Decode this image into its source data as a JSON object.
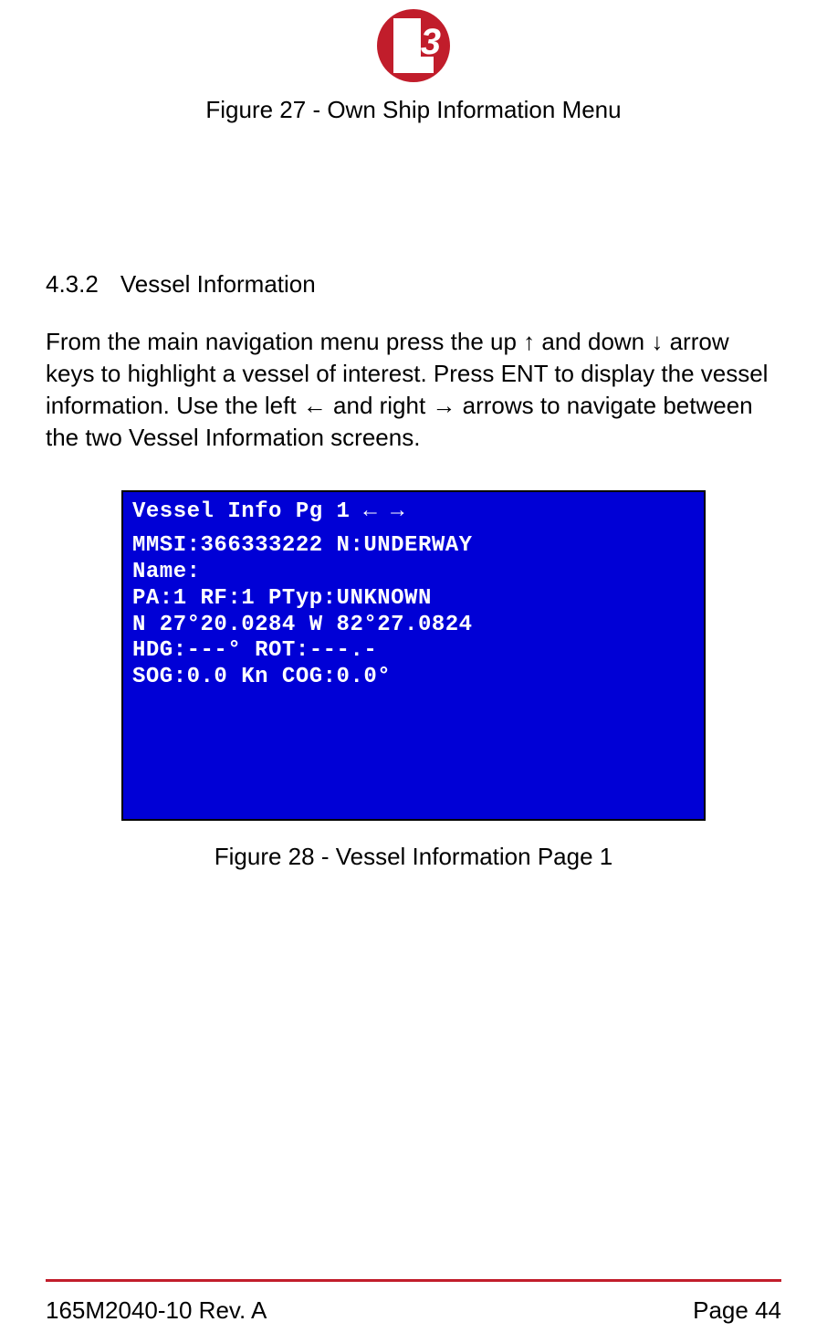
{
  "logo_text": "3",
  "figure27_caption": "Figure 27 - Own Ship Information Menu",
  "section": {
    "number": "4.3.2",
    "title": "Vessel Information"
  },
  "paragraph": "From the main navigation menu press the up ↑ and down ↓ arrow keys to highlight a vessel of interest.  Press ENT to display the vessel information.  Use the left ← and right → arrows to navigate between the two Vessel Information screens.",
  "screen": {
    "title": " Vessel Info Pg 1  ← →",
    "lines": [
      "MMSI:366333222 N:UNDERWAY",
      "Name:",
      "PA:1 RF:1 PTyp:UNKNOWN",
      "N 27°20.0284 W 82°27.0824",
      "HDG:---°      ROT:---.-",
      "SOG:0.0 Kn    COG:0.0°"
    ]
  },
  "figure28_caption": "Figure 28 - Vessel Information Page 1",
  "footer": {
    "left": "165M2040-10 Rev. A",
    "right": "Page 44"
  }
}
